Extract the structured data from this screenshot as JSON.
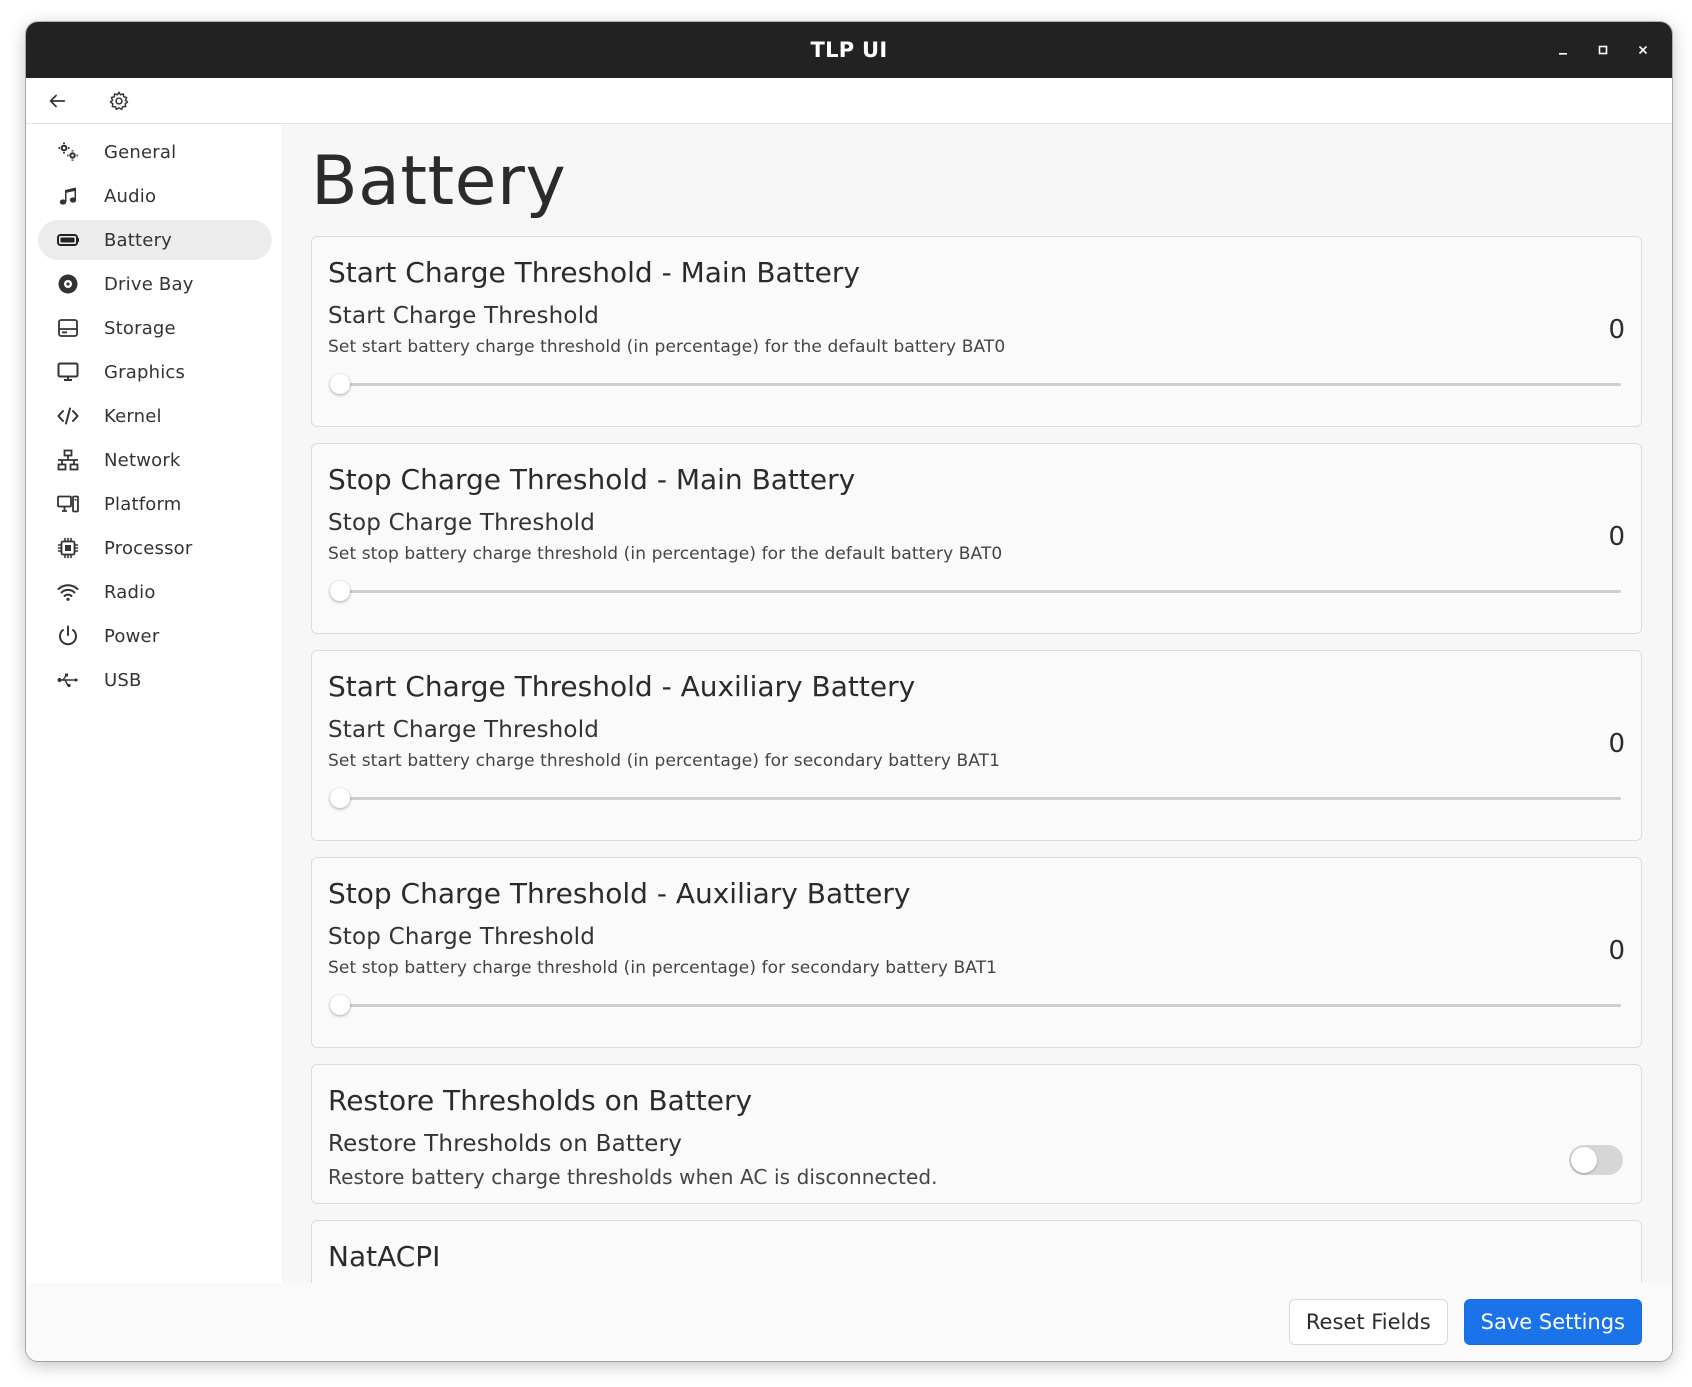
{
  "window": {
    "title": "TLP UI"
  },
  "colors": {
    "accent": "#1a73e8",
    "titlebar": "#222222",
    "slider_track": "#cfcfcf"
  },
  "toolbar": {
    "back_icon": "arrow-left-icon",
    "settings_icon": "gear-icon"
  },
  "sidebar": {
    "items": [
      {
        "label": "General",
        "icon": "gears-icon",
        "active": false
      },
      {
        "label": "Audio",
        "icon": "music-note-icon",
        "active": false
      },
      {
        "label": "Battery",
        "icon": "battery-icon",
        "active": true
      },
      {
        "label": "Drive Bay",
        "icon": "disc-icon",
        "active": false
      },
      {
        "label": "Storage",
        "icon": "hard-drive-icon",
        "active": false
      },
      {
        "label": "Graphics",
        "icon": "monitor-icon",
        "active": false
      },
      {
        "label": "Kernel",
        "icon": "code-icon",
        "active": false
      },
      {
        "label": "Network",
        "icon": "network-icon",
        "active": false
      },
      {
        "label": "Platform",
        "icon": "computer-tower-icon",
        "active": false
      },
      {
        "label": "Processor",
        "icon": "cpu-icon",
        "active": false
      },
      {
        "label": "Radio",
        "icon": "wifi-icon",
        "active": false
      },
      {
        "label": "Power",
        "icon": "power-icon",
        "active": false
      },
      {
        "label": "USB",
        "icon": "usb-icon",
        "active": false
      }
    ]
  },
  "main": {
    "title": "Battery",
    "cards": [
      {
        "title": "Start Charge Threshold - Main Battery",
        "label": "Start Charge Threshold",
        "description": "Set start battery charge threshold (in percentage) for the default battery BAT0",
        "value": "0",
        "slider_fraction": 0
      },
      {
        "title": "Stop Charge Threshold - Main Battery",
        "label": "Stop Charge Threshold",
        "description": "Set stop battery charge threshold (in percentage) for the default battery BAT0",
        "value": "0",
        "slider_fraction": 0
      },
      {
        "title": "Start Charge Threshold - Auxiliary Battery",
        "label": "Start Charge Threshold",
        "description": "Set start battery charge threshold (in percentage) for secondary battery BAT1",
        "value": "0",
        "slider_fraction": 0
      },
      {
        "title": "Stop Charge Threshold - Auxiliary Battery",
        "label": "Stop Charge Threshold",
        "description": "Set stop battery charge threshold (in percentage) for secondary battery BAT1",
        "value": "0",
        "slider_fraction": 0
      }
    ],
    "restore_card": {
      "title": "Restore Thresholds on Battery",
      "label": "Restore Thresholds on Battery",
      "description": "Restore battery charge thresholds when AC is disconnected.",
      "toggle_on": false
    },
    "natacpi_card": {
      "title": "NatACPI"
    }
  },
  "footer": {
    "reset_label": "Reset Fields",
    "save_label": "Save Settings"
  }
}
